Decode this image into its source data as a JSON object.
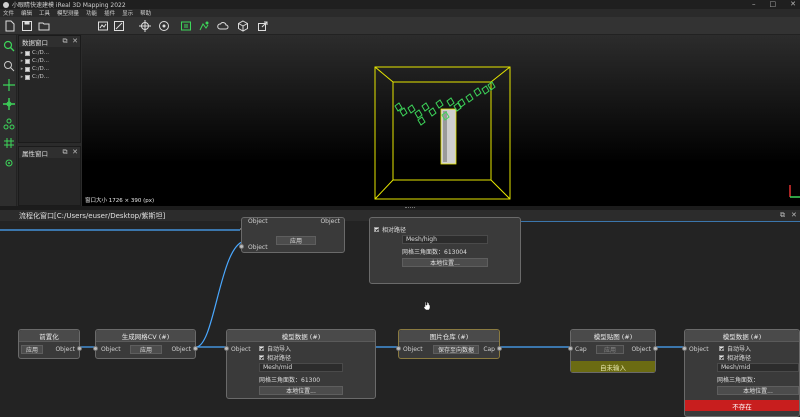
{
  "window": {
    "title": "小眼睛快速建模 iReal 3D Mapping 2022",
    "minimize": "–",
    "maximize": "□",
    "close": "✕"
  },
  "menu": [
    "文件",
    "编辑",
    "工具",
    "模型测量",
    "功能",
    "插件",
    "显示",
    "帮助"
  ],
  "toolbar_icons": [
    "new-file-icon",
    "save-icon",
    "folder-icon",
    "image-process-icon",
    "align-icon",
    "crosshair-icon",
    "mesh-icon",
    "camera-align-icon",
    "texture-icon",
    "cloud-icon",
    "cube-icon",
    "export-icon"
  ],
  "left_tools": [
    "search-icon",
    "zoom-icon",
    "move-icon",
    "gizmo-icon",
    "connect-icon",
    "grid-icon",
    "marker-icon"
  ],
  "data_panel": {
    "title": "数据窗口",
    "items": [
      "C:/D...",
      "C:/D...",
      "C:/D...",
      "C:/D..."
    ]
  },
  "properties_panel": {
    "title": "属性窗口"
  },
  "viewport": {
    "size_label": "窗口大小 1726 × 390 (px)"
  },
  "flow": {
    "title": "流程化窗口[C:/Users/euser/Desktop/紫斯坦]",
    "nodes": {
      "top_left": {
        "out_left": "Object",
        "out_right": "Object",
        "in": "Object",
        "button": "应用"
      },
      "top_model": {
        "relative_path": "相对路径",
        "field": "Mesh/high",
        "triangles": "网格三角面数：613004",
        "local_button": "本地位置..."
      },
      "partial": {
        "title": "前置化",
        "button": "应用",
        "out": "Object"
      },
      "gen_grid": {
        "title": "生成网格CV (#)",
        "in": "Object",
        "button": "应用",
        "out": "Object"
      },
      "model_data_1": {
        "title": "模型数据 (#)",
        "in": "Object",
        "auto_import": "自动导入",
        "relative_path": "相对路径",
        "field": "Mesh/mid",
        "triangles": "网格三角面数：61300",
        "local_button": "本地位置..."
      },
      "texture_lib": {
        "title": "图片仓库 (#)",
        "in": "Object",
        "button": "保存至向数据",
        "out": "Cap"
      },
      "model_texture": {
        "title": "模型贴图 (#)",
        "in": "Cap",
        "button": "应用",
        "out": "Object",
        "status": "自未输入"
      },
      "model_data_2": {
        "title": "模型数据 (#)",
        "in": "Object",
        "auto_import": "自动导入",
        "relative_path": "相对路径",
        "field": "Mesh/mid",
        "triangles": "网格三角面数：",
        "local_button": "本地位置...",
        "status": "不存在"
      }
    }
  },
  "colors": {
    "accent_green": "#3dd65a",
    "bbox_yellow": "#e6e600",
    "link_blue": "#4aa8ff",
    "status_yellow": "#6b6b12",
    "status_red": "#c81e1e"
  }
}
